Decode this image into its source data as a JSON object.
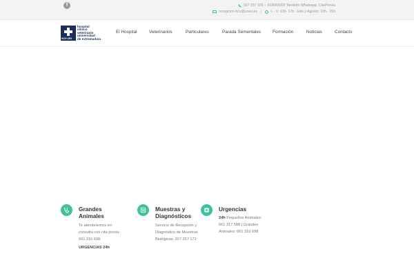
{
  "topbar": {
    "facebook_glyph": "f",
    "phone_line": "927 257 102 – 619081929 También Whatsapp. CitaPrevia",
    "email": "recepcion-hcv@unex.es",
    "separator": "|",
    "hours": "L - V: 10h- 17h. Julio y Agosto: 10h - 15h"
  },
  "logo": {
    "mark_text": "HCV·UEX",
    "lines": [
      "hospital",
      "clínico",
      "veterinario",
      "universidad",
      "de extremadura"
    ]
  },
  "nav": {
    "items": [
      "El Hospital",
      "Veterinarios",
      "Particulares",
      "Parada Sementales",
      "Formación",
      "Noticias",
      "Contacto"
    ]
  },
  "features": [
    {
      "icon": "stethoscope-icon",
      "title_lines": [
        "Grandes",
        "Animales"
      ],
      "body_lines": [
        "Te atenderemos en",
        "consulta con cita previa:",
        "661 316 698."
      ],
      "extra": "URGENCIAS 24h"
    },
    {
      "icon": "hospital-icon",
      "title_lines": [
        "Muestras y",
        "Diagnósticos"
      ],
      "body_lines": [
        "Servicio de Recepción y",
        "Diagnóstico de Muestras",
        "Biológicas: 927 257 172"
      ]
    },
    {
      "icon": "medical-cross-icon",
      "title_lines": [
        "Urgencias"
      ],
      "body_strong": "24h",
      "body_lines": [
        " Pequeños Animales:",
        "661 317 588 | Grandes",
        "Animales: 661 316 698"
      ]
    }
  ],
  "colors": {
    "accent": "#3fc1a0",
    "brand": "#1c2e5a",
    "topbar_bg": "#f3f3f3"
  }
}
